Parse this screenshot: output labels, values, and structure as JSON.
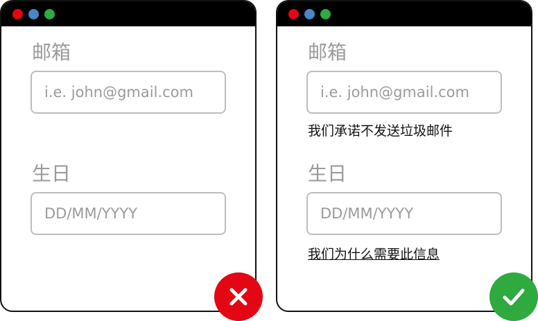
{
  "examples": [
    {
      "email_label": "邮箱",
      "email_placeholder": "i.e. john@gmail.com",
      "dob_label": "生日",
      "dob_placeholder": "DD/MM/YYYY",
      "result_icon": "close-icon"
    },
    {
      "email_label": "邮箱",
      "email_placeholder": "i.e. john@gmail.com",
      "email_helper": "我们承诺不发送垃圾邮件",
      "dob_label": "生日",
      "dob_placeholder": "DD/MM/YYYY",
      "dob_helper_link": "我们为什么需要此信息",
      "result_icon": "check-icon"
    }
  ],
  "colors": {
    "window_dots": [
      "#e30613",
      "#4a86c6",
      "#2eaa3f"
    ],
    "bad": "#e30613",
    "good": "#2eaa3f"
  }
}
